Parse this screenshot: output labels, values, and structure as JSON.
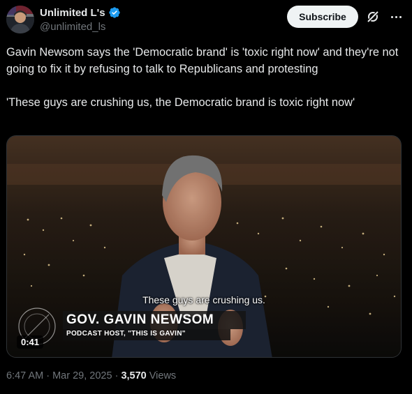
{
  "author": {
    "display_name": "Unlimited L's",
    "handle": "@unlimited_ls",
    "verified_color": "#1d9bf0"
  },
  "actions": {
    "subscribe_label": "Subscribe",
    "grok_icon": "grok-icon",
    "more_icon": "more-icon"
  },
  "tweet": {
    "text_line1": "Gavin Newsom says the 'Democratic brand' is 'toxic right now' and they're not going to fix it by refusing to talk to Republicans and protesting",
    "text_line2": "'These guys are crushing us, the Democratic brand is toxic right now'"
  },
  "media": {
    "subtitle": "These guys are crushing us.",
    "chyron_name": "GOV. GAVIN NEWSOM",
    "chyron_title": "PODCAST HOST, \"THIS IS GAVIN\"",
    "duration": "0:41"
  },
  "meta": {
    "time": "6:47 AM",
    "separator1": " · ",
    "date": "Mar 29, 2025",
    "separator2": " · ",
    "views_count": "3,570",
    "views_label": " Views"
  }
}
